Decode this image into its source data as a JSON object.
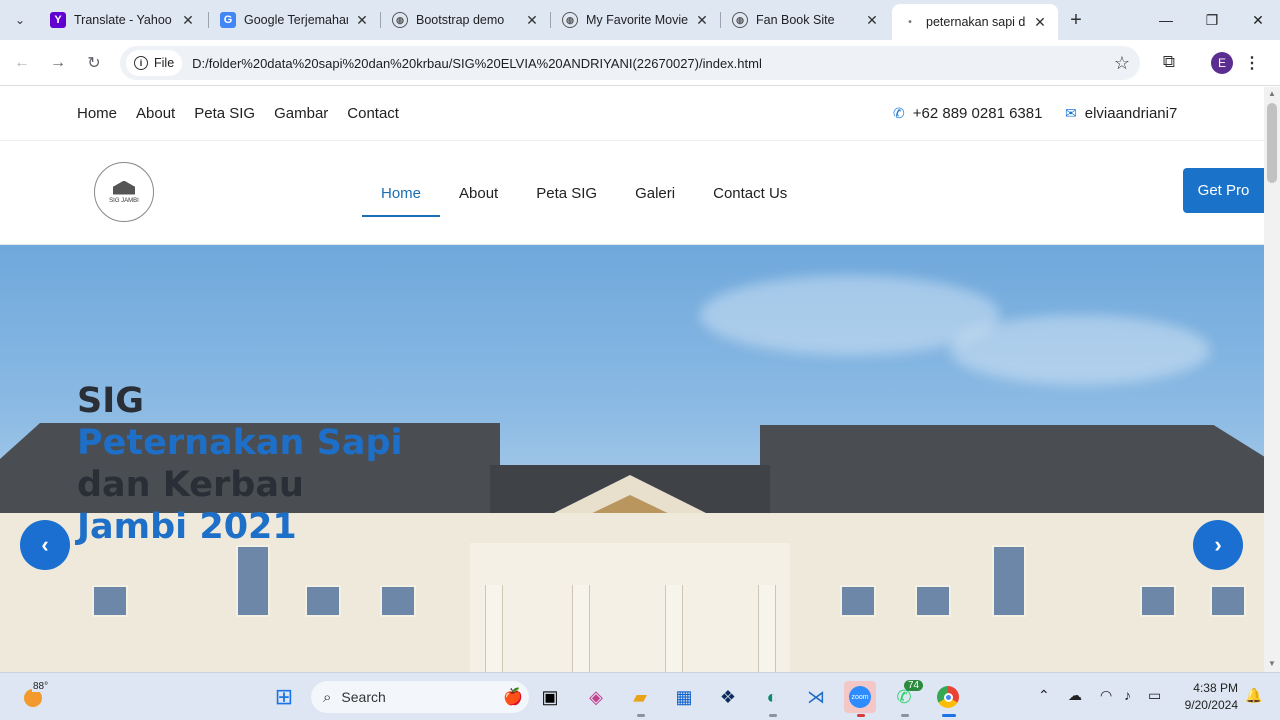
{
  "browser": {
    "tabs": [
      {
        "title": "Translate - Yahoo S",
        "favicon": "Y",
        "favicon_color": "#6001d2"
      },
      {
        "title": "Google Terjemahan",
        "favicon": "G",
        "favicon_color": "#4285f4"
      },
      {
        "title": "Bootstrap demo",
        "favicon": "globe",
        "favicon_color": "#5f6368"
      },
      {
        "title": "My Favorite Movie",
        "favicon": "globe",
        "favicon_color": "#5f6368"
      },
      {
        "title": "Fan Book Site",
        "favicon": "globe",
        "favicon_color": "#5f6368"
      },
      {
        "title": "peternakan sapi da",
        "favicon": "page",
        "favicon_color": "#5f6368",
        "active": true
      }
    ],
    "site_info_label": "File",
    "url": "D:/folder%20data%20sapi%20dan%20krbau/SIG%20ELVIA%20ANDRIYANI(22670027)/index.html",
    "profile_initial": "E"
  },
  "page": {
    "topbar": {
      "links": [
        "Home",
        "About",
        "Peta SIG",
        "Gambar",
        "Contact"
      ],
      "phone": "+62 889 0281 6381",
      "email": "elviaandriani7"
    },
    "header": {
      "logo_text": "SIG JAMBI",
      "nav": [
        "Home",
        "About",
        "Peta SIG",
        "Galeri",
        "Contact Us"
      ],
      "active_nav": "Home",
      "cta": "Get Pro"
    },
    "hero": {
      "line1": "SIG",
      "line2": "Peternakan Sapi",
      "line3": "dan Kerbau",
      "line4": "Jambi 2021"
    }
  },
  "taskbar": {
    "temperature": "88°",
    "search_placeholder": "Search",
    "whatsapp_badge": "74",
    "time": "4:38 PM",
    "date": "9/20/2024"
  },
  "colors": {
    "accent": "#1a6fb5",
    "hero_blue": "#1e6fc8",
    "cta": "#1a73c9"
  }
}
